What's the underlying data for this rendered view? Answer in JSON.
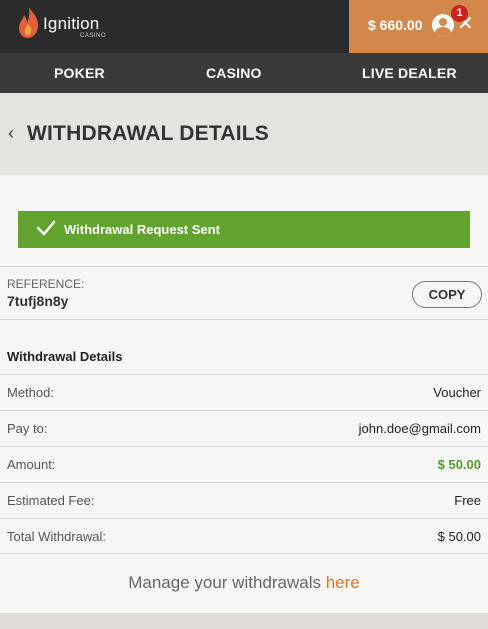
{
  "brand": {
    "name": "Ignition",
    "sub": "CASINO",
    "accent": "#d1884a",
    "logo_icon": "flame-icon"
  },
  "account": {
    "balance": "$ 660.00",
    "notifications": "1",
    "avatar_icon": "user-icon",
    "close_icon": "close-icon",
    "close_glyph": "✕"
  },
  "nav": {
    "items": [
      {
        "label": "POKER"
      },
      {
        "label": "CASINO"
      },
      {
        "label": "LIVE DEALER"
      }
    ]
  },
  "header": {
    "back_glyph": "‹",
    "title": "WITHDRAWAL DETAILS"
  },
  "success": {
    "message": "Withdrawal Request Sent",
    "color": "#62a32e"
  },
  "reference": {
    "label": "REFERENCE:",
    "value": "7tufj8n8y",
    "copy_label": "COPY"
  },
  "details": {
    "title": "Withdrawal Details",
    "rows": [
      {
        "label": "Method:",
        "value": "Voucher"
      },
      {
        "label": "Pay to:",
        "value": "john.doe@gmail.com"
      },
      {
        "label": "Amount:",
        "value": "$ 50.00"
      },
      {
        "label": "Estimated Fee:",
        "value": "Free"
      },
      {
        "label": "Total Withdrawal:",
        "value": "$ 50.00"
      }
    ]
  },
  "manage": {
    "text": "Manage your withdrawals ",
    "link": "here"
  }
}
